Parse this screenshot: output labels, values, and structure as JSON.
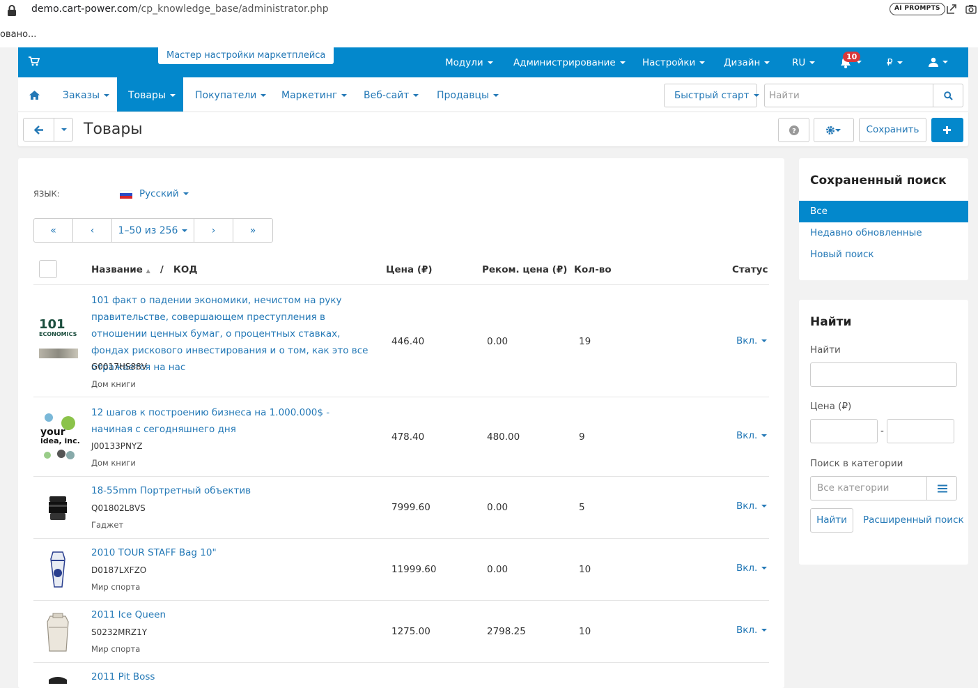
{
  "browser": {
    "url_domain": "demo.cart-power.com",
    "url_path": "/cp_knowledge_base/administrator.php",
    "ai_prompts": "AI PROMPTS",
    "tooltip_text": "овано..."
  },
  "topnav": {
    "wizard": "Мастер настройки маркетплейса",
    "items": [
      "Модули",
      "Администрирование",
      "Настройки",
      "Дизайн",
      "RU"
    ],
    "notif_count": "10",
    "currency": "₽"
  },
  "subnav": {
    "items": [
      "Заказы",
      "Товары",
      "Покупатели",
      "Маркетинг",
      "Веб-сайт",
      "Продавцы"
    ],
    "quick_start": "Быстрый старт",
    "search_placeholder": "Найти"
  },
  "titlebar": {
    "title": "Товары",
    "save": "Сохранить"
  },
  "main": {
    "lang_label": "ЯЗЫК:",
    "lang_value": "Русский",
    "pager": {
      "first": "«",
      "prev": "‹",
      "range": "1–50 из 256",
      "next": "›",
      "last": "»"
    },
    "columns": {
      "name": "Название",
      "sep": "/",
      "code": "КОД",
      "price": "Цена (₽)",
      "rec_price": "Реком. цена (₽)",
      "qty": "Кол-во",
      "status": "Статус"
    },
    "rows": [
      {
        "name": "101 факт о падении экономики, нечистом на руку правительстве, совершающем преступления в отношении ценных бумаг, о процентных ставках, фондах рискового инвестирования и о том, как это все отражается на нас",
        "code": "G0017HS88V",
        "vendor": "Дом книги",
        "price": "446.40",
        "rec_price": "0.00",
        "qty": "19",
        "status": "Вкл.",
        "thumb_text": "101",
        "thumb_text2": "ECONOMICS"
      },
      {
        "name": "12 шагов к построению бизнеса на 1.000.000$ - начиная с сегодняшнего дня",
        "code": "J00133PNYZ",
        "vendor": "Дом книги",
        "price": "478.40",
        "rec_price": "480.00",
        "qty": "9",
        "status": "Вкл.",
        "thumb_text": "your",
        "thumb_text2": "idea, inc."
      },
      {
        "name": "18-55mm Портретный объектив",
        "code": "Q01802L8VS",
        "vendor": "Гаджет",
        "price": "7999.60",
        "rec_price": "0.00",
        "qty": "5",
        "status": "Вкл."
      },
      {
        "name": "2010 TOUR STAFF Bag 10\"",
        "code": "D0187LXFZO",
        "vendor": "Мир спорта",
        "price": "11999.60",
        "rec_price": "0.00",
        "qty": "10",
        "status": "Вкл."
      },
      {
        "name": "2011 Ice Queen",
        "code": "S0232MRZ1Y",
        "vendor": "Мир спорта",
        "price": "1275.00",
        "rec_price": "2798.25",
        "qty": "10",
        "status": "Вкл."
      },
      {
        "name": "2011 Pit Boss"
      }
    ]
  },
  "saved_search": {
    "title": "Сохраненный поиск",
    "items": [
      "Все",
      "Недавно обновленные",
      "Новый поиск"
    ]
  },
  "find": {
    "title": "Найти",
    "find_label": "Найти",
    "price_label": "Цена (₽)",
    "dash": "-",
    "category_label": "Поиск в категории",
    "category_placeholder": "Все категории",
    "find_button": "Найти",
    "advanced": "Расширенный поиск"
  }
}
